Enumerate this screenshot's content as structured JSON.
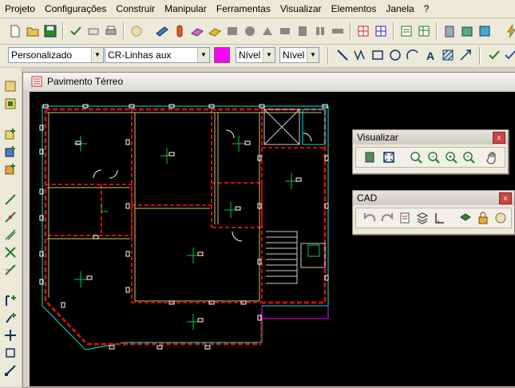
{
  "menu": [
    "Projeto",
    "Configurações",
    "Construir",
    "Manipular",
    "Ferramentas",
    "Visualizar",
    "Elementos",
    "Janela",
    "?"
  ],
  "toolbar2": {
    "style_combo": "Personalizado",
    "layer_combo": "CR-Linhas aux",
    "color_swatch": "#ff00ff",
    "level_combo_1": "Nível",
    "level_combo_2": "Nível"
  },
  "document": {
    "title": "Pavimento Térreo"
  },
  "panels": {
    "visualizar": {
      "title": "Visualizar",
      "close": "x"
    },
    "cad": {
      "title": "CAD",
      "close": "x"
    }
  },
  "colors": {
    "canvas_bg": "#000000",
    "wall": "#cc1010",
    "outline": "#00e5e5",
    "beam": "#c8c864",
    "dim": "#ffffff"
  }
}
